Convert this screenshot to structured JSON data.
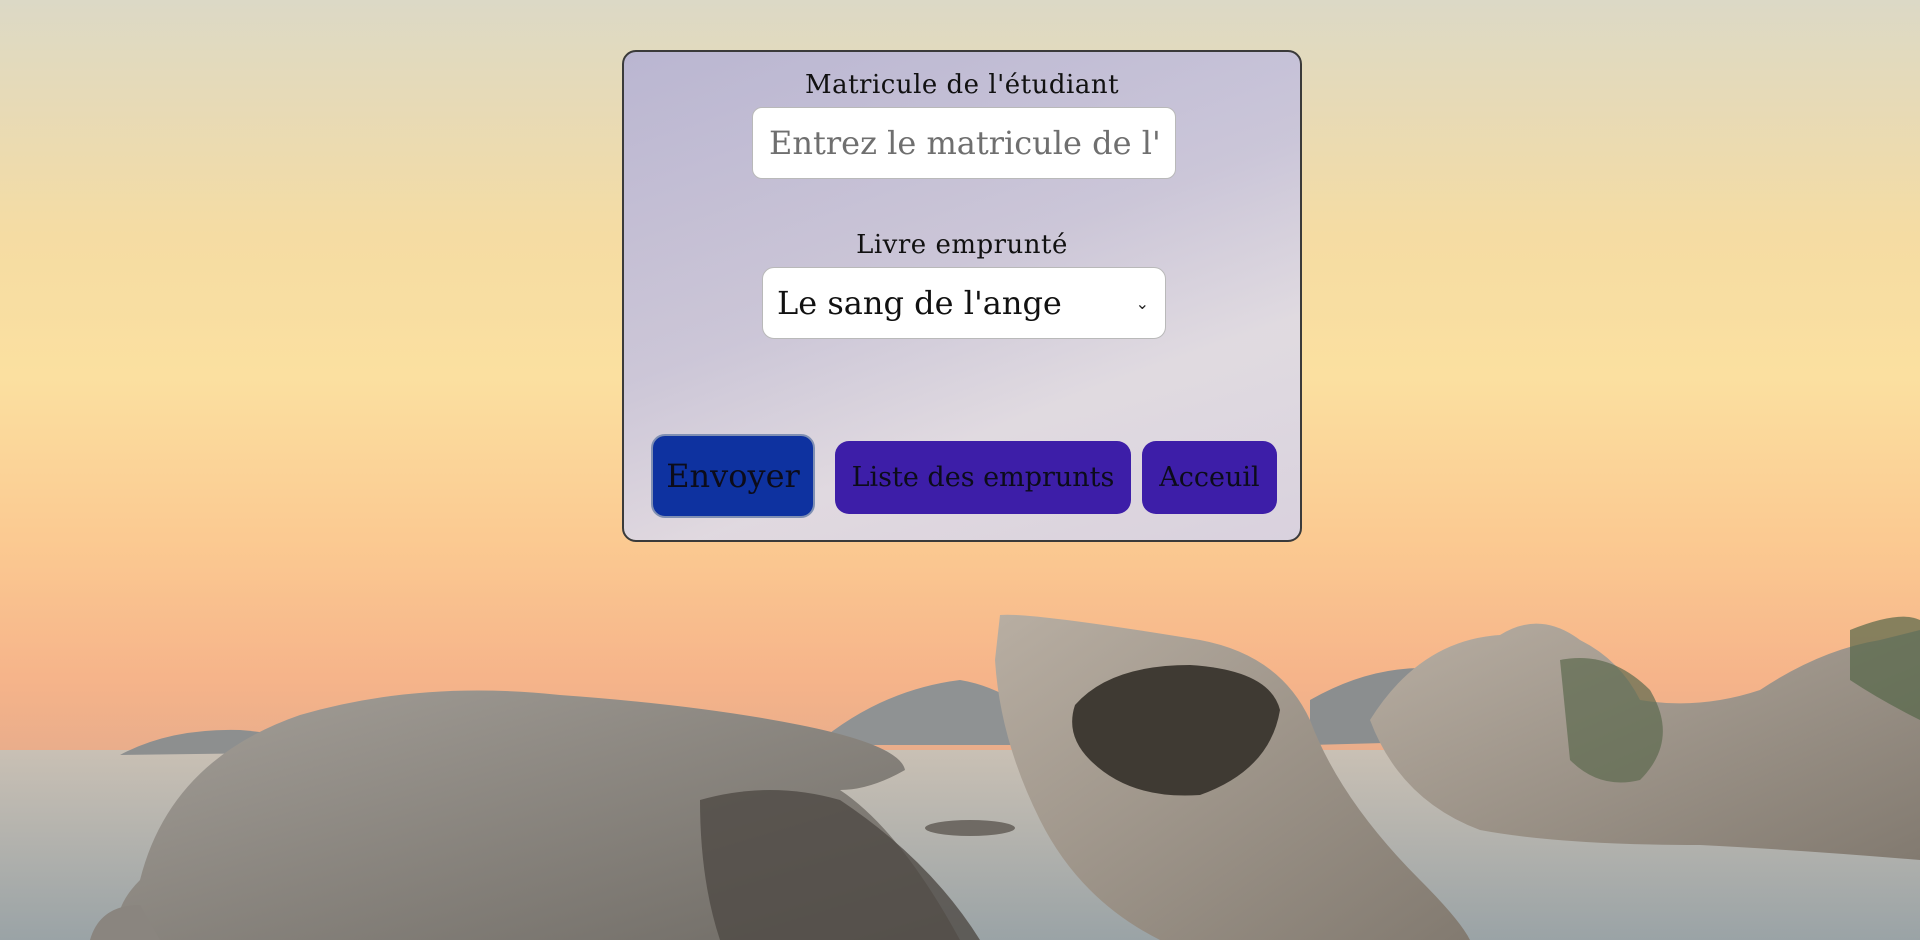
{
  "form": {
    "matricule_label": "Matricule de l'étudiant",
    "matricule_placeholder": "Entrez le matricule de l'é",
    "livre_label": "Livre emprunté",
    "livre_selected": "Le sang de l'ange"
  },
  "buttons": {
    "envoyer": "Envoyer",
    "liste": "Liste des emprunts",
    "accueil": "Acceuil"
  },
  "icons": {
    "select_arrow": "chevron-down-icon"
  },
  "colors": {
    "envoyer_button": "#0e32a0",
    "secondary_button": "#3d1ea8",
    "card_border": "#3a3a3a"
  }
}
